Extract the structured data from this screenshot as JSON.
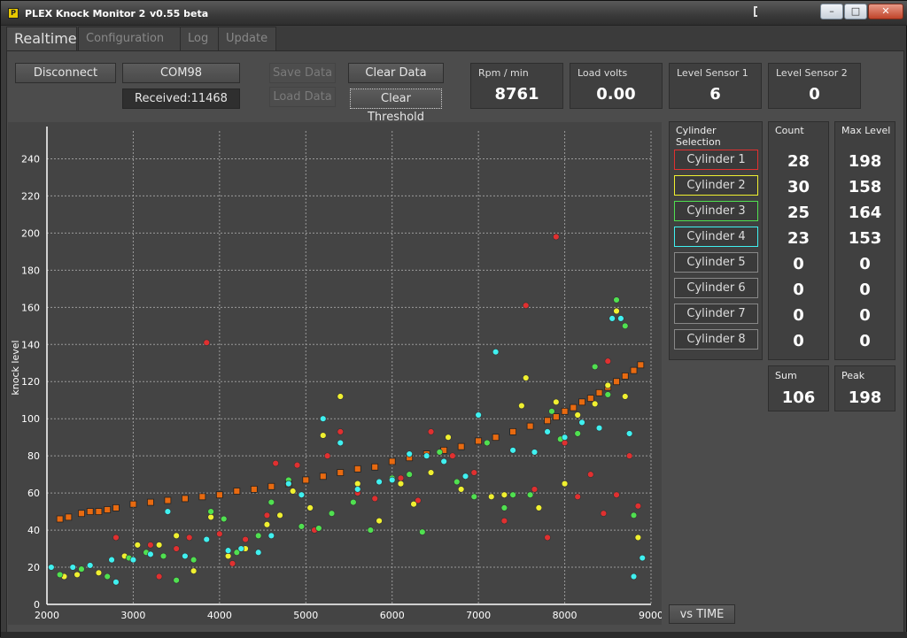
{
  "window": {
    "title": "PLEX Knock Monitor 2",
    "version": "v0.55 beta",
    "min_label": "–",
    "max_label": "□",
    "close_label": "✕"
  },
  "tabs": [
    {
      "label": "Realtime"
    },
    {
      "label": "Configuration"
    },
    {
      "label": "Log"
    },
    {
      "label": "Update"
    }
  ],
  "controls": {
    "disconnect": "Disconnect",
    "port": "COM98",
    "received": "Received:11468",
    "save_data": "Save Data",
    "load_data": "Load Data",
    "clear_data": "Clear Data",
    "clear_threshold": "Clear Threshold",
    "vs_time": "vs TIME"
  },
  "stats": [
    {
      "label": "Rpm / min",
      "value": "8761"
    },
    {
      "label": "Load volts",
      "value": "0.00"
    },
    {
      "label": "Level Sensor 1",
      "value": "6"
    },
    {
      "label": "Level Sensor 2",
      "value": "0"
    }
  ],
  "cylinders": {
    "title": "Cylinder Selection",
    "count_title": "Count",
    "max_title": "Max Level",
    "items": [
      {
        "label": "Cylinder 1",
        "color": "#e03030",
        "count": "28",
        "max": "198"
      },
      {
        "label": "Cylinder 2",
        "color": "#f0f030",
        "count": "30",
        "max": "158"
      },
      {
        "label": "Cylinder 3",
        "color": "#50e050",
        "count": "25",
        "max": "164"
      },
      {
        "label": "Cylinder 4",
        "color": "#40f0f0",
        "count": "23",
        "max": "153"
      },
      {
        "label": "Cylinder 5",
        "color": "#888888",
        "count": "0",
        "max": "0"
      },
      {
        "label": "Cylinder 6",
        "color": "#888888",
        "count": "0",
        "max": "0"
      },
      {
        "label": "Cylinder 7",
        "color": "#888888",
        "count": "0",
        "max": "0"
      },
      {
        "label": "Cylinder 8",
        "color": "#888888",
        "count": "0",
        "max": "0"
      }
    ]
  },
  "summary": {
    "sum_label": "Sum",
    "sum_value": "106",
    "peak_label": "Peak",
    "peak_value": "198"
  },
  "chart_data": {
    "type": "scatter",
    "ylabel": "knock level",
    "xlim": [
      2000,
      9000
    ],
    "ylim": [
      0,
      255
    ],
    "x_ticks": [
      2000,
      3000,
      4000,
      5000,
      6000,
      7000,
      8000,
      9000
    ],
    "y_ticks": [
      0,
      20,
      40,
      60,
      80,
      100,
      120,
      140,
      160,
      180,
      200,
      220,
      240
    ],
    "grid": true,
    "threshold": {
      "name": "threshold",
      "color": "#e86a10",
      "points": [
        [
          2150,
          46
        ],
        [
          2250,
          47
        ],
        [
          2400,
          49
        ],
        [
          2500,
          50
        ],
        [
          2600,
          50
        ],
        [
          2700,
          51
        ],
        [
          2800,
          52
        ],
        [
          3000,
          54
        ],
        [
          3200,
          55
        ],
        [
          3400,
          56
        ],
        [
          3600,
          57
        ],
        [
          3800,
          58
        ],
        [
          4000,
          59
        ],
        [
          4200,
          61
        ],
        [
          4400,
          62
        ],
        [
          4600,
          63.5
        ],
        [
          4800,
          65
        ],
        [
          5000,
          67
        ],
        [
          5200,
          69
        ],
        [
          5400,
          71
        ],
        [
          5600,
          73
        ],
        [
          5800,
          74
        ],
        [
          6000,
          77
        ],
        [
          6200,
          79
        ],
        [
          6400,
          81
        ],
        [
          6600,
          83
        ],
        [
          6800,
          85
        ],
        [
          7000,
          88
        ],
        [
          7200,
          90
        ],
        [
          7400,
          93
        ],
        [
          7600,
          96
        ],
        [
          7800,
          99
        ],
        [
          7900,
          101
        ],
        [
          8000,
          104
        ],
        [
          8100,
          106
        ],
        [
          8200,
          109
        ],
        [
          8300,
          111
        ],
        [
          8400,
          114
        ],
        [
          8500,
          117
        ],
        [
          8600,
          120
        ],
        [
          8700,
          123
        ],
        [
          8800,
          126
        ],
        [
          8880,
          129
        ]
      ]
    },
    "series": [
      {
        "name": "Cylinder 1",
        "color": "#e03030",
        "points": [
          [
            2800,
            36
          ],
          [
            3200,
            32
          ],
          [
            3300,
            15
          ],
          [
            3500,
            30
          ],
          [
            3650,
            36
          ],
          [
            3850,
            141
          ],
          [
            4000,
            38
          ],
          [
            4150,
            22
          ],
          [
            4300,
            35
          ],
          [
            4550,
            48
          ],
          [
            4650,
            76
          ],
          [
            4900,
            75
          ],
          [
            5100,
            40
          ],
          [
            5250,
            80
          ],
          [
            5400,
            93
          ],
          [
            5600,
            60
          ],
          [
            5800,
            57
          ],
          [
            6100,
            68
          ],
          [
            6300,
            56
          ],
          [
            6450,
            93
          ],
          [
            6700,
            80
          ],
          [
            6950,
            71
          ],
          [
            7300,
            45
          ],
          [
            7550,
            161
          ],
          [
            7650,
            62
          ],
          [
            7800,
            36
          ],
          [
            7900,
            198
          ],
          [
            8000,
            87
          ],
          [
            8150,
            58
          ],
          [
            8300,
            70
          ],
          [
            8450,
            49
          ],
          [
            8500,
            131
          ],
          [
            8600,
            59
          ],
          [
            8750,
            80
          ],
          [
            8850,
            53
          ]
        ]
      },
      {
        "name": "Cylinder 2",
        "color": "#f0f030",
        "points": [
          [
            2200,
            15
          ],
          [
            2350,
            16
          ],
          [
            2600,
            17
          ],
          [
            2900,
            26
          ],
          [
            3050,
            32
          ],
          [
            3300,
            32
          ],
          [
            3500,
            37
          ],
          [
            3700,
            18
          ],
          [
            3900,
            47
          ],
          [
            4100,
            26
          ],
          [
            4300,
            30
          ],
          [
            4550,
            43
          ],
          [
            4700,
            48
          ],
          [
            4850,
            61
          ],
          [
            5050,
            52
          ],
          [
            5200,
            91
          ],
          [
            5400,
            112
          ],
          [
            5600,
            65
          ],
          [
            5850,
            45
          ],
          [
            6100,
            65
          ],
          [
            6250,
            54
          ],
          [
            6450,
            71
          ],
          [
            6650,
            90
          ],
          [
            6800,
            62
          ],
          [
            7000,
            102
          ],
          [
            7150,
            58
          ],
          [
            7300,
            59
          ],
          [
            7500,
            107
          ],
          [
            7550,
            122
          ],
          [
            7700,
            52
          ],
          [
            7900,
            109
          ],
          [
            8000,
            65
          ],
          [
            8150,
            102
          ],
          [
            8350,
            108
          ],
          [
            8500,
            118
          ],
          [
            8600,
            158
          ],
          [
            8700,
            112
          ],
          [
            8850,
            36
          ]
        ]
      },
      {
        "name": "Cylinder 3",
        "color": "#50e050",
        "points": [
          [
            2150,
            16
          ],
          [
            2400,
            19
          ],
          [
            2700,
            15
          ],
          [
            2950,
            25
          ],
          [
            3150,
            28
          ],
          [
            3350,
            26
          ],
          [
            3500,
            13
          ],
          [
            3700,
            24
          ],
          [
            3900,
            50
          ],
          [
            4050,
            46
          ],
          [
            4200,
            28
          ],
          [
            4450,
            37
          ],
          [
            4600,
            55
          ],
          [
            4800,
            67
          ],
          [
            4950,
            42
          ],
          [
            5150,
            41
          ],
          [
            5300,
            49
          ],
          [
            5550,
            55
          ],
          [
            5750,
            40
          ],
          [
            6000,
            68
          ],
          [
            6200,
            70
          ],
          [
            6350,
            39
          ],
          [
            6550,
            82
          ],
          [
            6750,
            66
          ],
          [
            6950,
            58
          ],
          [
            7100,
            87
          ],
          [
            7300,
            52
          ],
          [
            7400,
            59
          ],
          [
            7600,
            59
          ],
          [
            7850,
            104
          ],
          [
            7950,
            89
          ],
          [
            8150,
            92
          ],
          [
            8350,
            128
          ],
          [
            8500,
            113
          ],
          [
            8600,
            164
          ],
          [
            8700,
            150
          ],
          [
            8800,
            48
          ]
        ]
      },
      {
        "name": "Cylinder 4",
        "color": "#40f0f0",
        "points": [
          [
            2050,
            20
          ],
          [
            2300,
            20
          ],
          [
            2500,
            21
          ],
          [
            2750,
            24
          ],
          [
            2800,
            12
          ],
          [
            3000,
            24
          ],
          [
            3200,
            27
          ],
          [
            3400,
            50
          ],
          [
            3600,
            26
          ],
          [
            3850,
            35
          ],
          [
            4100,
            29
          ],
          [
            4250,
            30
          ],
          [
            4450,
            28
          ],
          [
            4600,
            37
          ],
          [
            4800,
            65
          ],
          [
            4950,
            59
          ],
          [
            5200,
            100
          ],
          [
            5400,
            87
          ],
          [
            5600,
            62
          ],
          [
            5850,
            66
          ],
          [
            6000,
            67
          ],
          [
            6200,
            81
          ],
          [
            6400,
            80
          ],
          [
            6600,
            77
          ],
          [
            6850,
            69
          ],
          [
            7000,
            102
          ],
          [
            7200,
            136
          ],
          [
            7400,
            83
          ],
          [
            7650,
            82
          ],
          [
            7800,
            93
          ],
          [
            8000,
            90
          ],
          [
            8200,
            98
          ],
          [
            8400,
            95
          ],
          [
            8550,
            154
          ],
          [
            8650,
            154
          ],
          [
            8750,
            92
          ],
          [
            8800,
            15
          ],
          [
            8900,
            25
          ]
        ]
      }
    ]
  }
}
